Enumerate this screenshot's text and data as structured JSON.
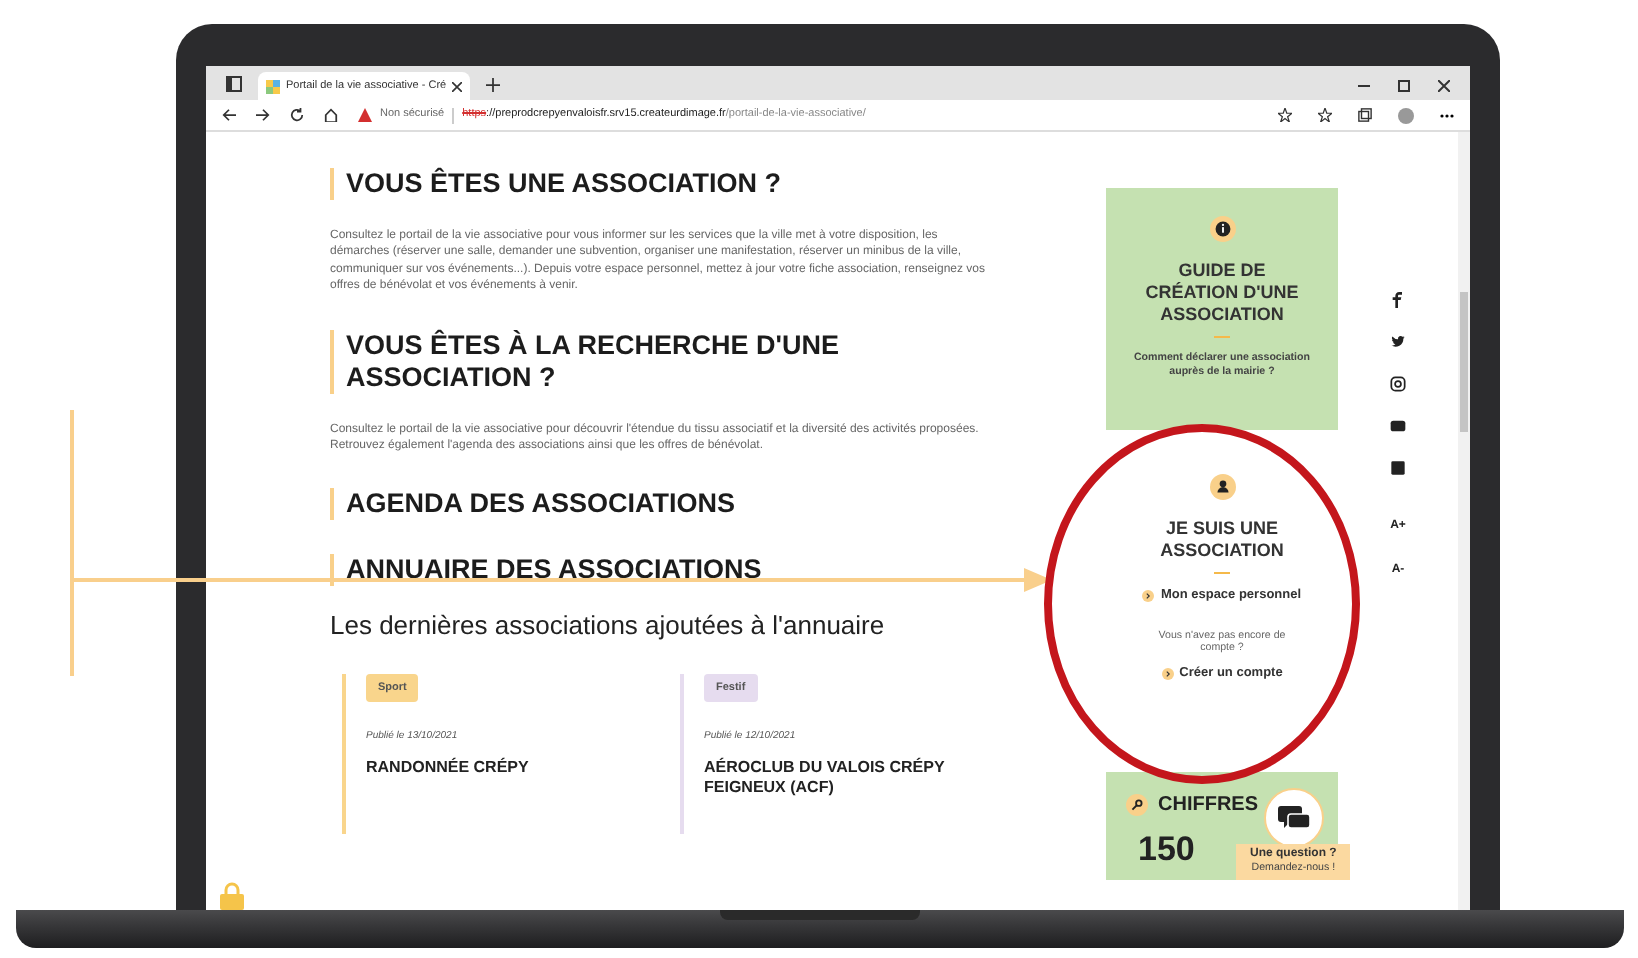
{
  "browser": {
    "tab_title": "Portail de la vie associative - Cré",
    "security": "Non sécurisé",
    "url_scheme": "https",
    "url_host": "://preprodcrepyenvaloisfr.srv15.createurdimage.fr",
    "url_path": "/portail-de-la-vie-associative/"
  },
  "sections": [
    {
      "heading": "VOUS ÊTES UNE ASSOCIATION ?",
      "text": "Consultez le portail de la vie associative pour vous informer sur les services que la ville met à votre disposition, les démarches (réserver une salle, demander une subvention, organiser une manifestation, réserver un minibus de la ville, communiquer sur vos événements...). Depuis votre espace personnel, mettez à jour votre fiche association, renseignez vos offres de bénévolat et vos événements à venir."
    },
    {
      "heading": "VOUS ÊTES À LA RECHERCHE D'UNE ASSOCIATION ?",
      "text": "Consultez le portail de la vie associative pour découvrir l'étendue du tissu associatif et la diversité des activités proposées. Retrouvez également l'agenda des associations ainsi que les offres de bénévolat."
    },
    {
      "heading": "AGENDA DES ASSOCIATIONS"
    },
    {
      "heading": "ANNUAIRE DES ASSOCIATIONS"
    }
  ],
  "subtitle": "Les dernières associations ajoutées à l'annuaire",
  "cards": [
    {
      "tag": "Sport",
      "color": "#f9d58c",
      "date": "Publié le 13/10/2021",
      "title": "RANDONNÉE CRÉPY"
    },
    {
      "tag": "Festif",
      "color": "#e6dcef",
      "date": "Publié le 12/10/2021",
      "title": "AÉROCLUB DU VALOIS CRÉPY FEIGNEUX (ACF)"
    }
  ],
  "guide": {
    "title": "GUIDE DE CRÉATION D'UNE ASSOCIATION",
    "subtitle": "Comment déclarer une association auprès de la mairie ?"
  },
  "account": {
    "title": "JE SUIS UNE ASSOCIATION",
    "link": "Mon espace personnel",
    "note": "Vous n'avez pas encore de compte ?",
    "create": "Créer un compte"
  },
  "font_controls": [
    "A+",
    "A-"
  ],
  "figures": {
    "title": "CHIFFRES",
    "value": "150"
  },
  "chat": {
    "title": "Une question ?",
    "subtitle": "Demandez-nous !"
  }
}
